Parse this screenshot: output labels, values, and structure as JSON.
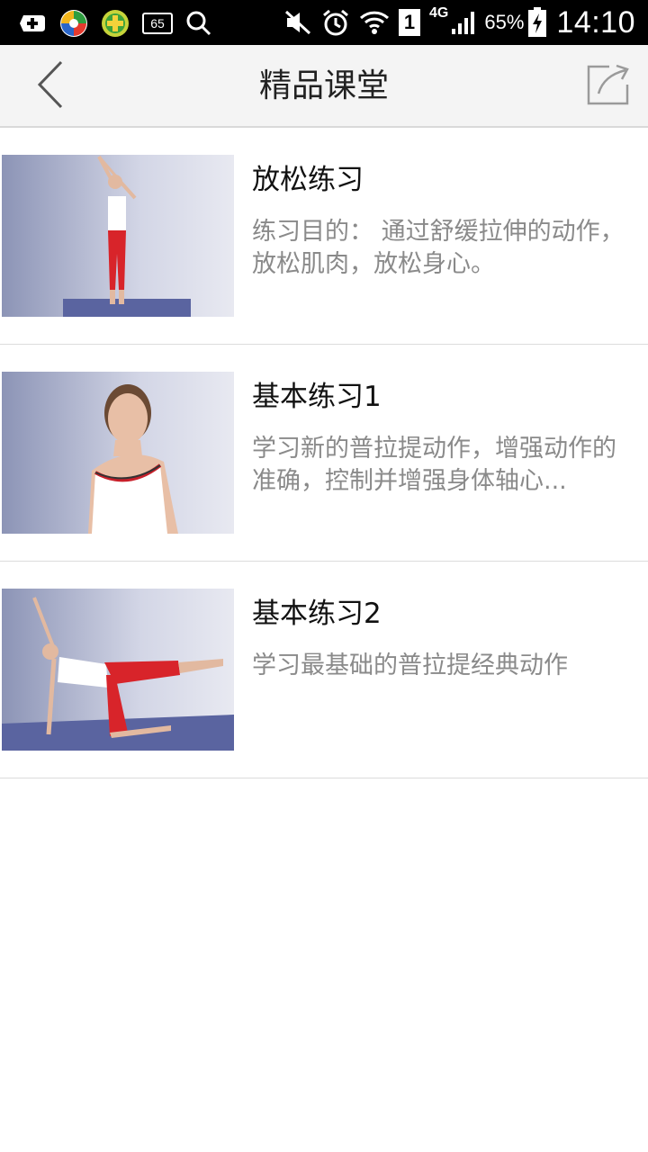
{
  "status_bar": {
    "left_icons": [
      "add-box-icon",
      "colorful-swirl-icon",
      "green-plus-icon",
      "badge-65-icon",
      "search-icon"
    ],
    "badge_text": "65",
    "right_icons": [
      "mute-icon",
      "alarm-icon",
      "wifi-icon",
      "sim-1-icon",
      "signal-4g-icon",
      "battery-charging-icon"
    ],
    "sim_label": "1",
    "network_label": "4G",
    "battery_percent": "65%",
    "time": "14:10"
  },
  "app_bar": {
    "title": "精品课堂",
    "back_icon": "chevron-left-icon",
    "share_icon": "share-icon"
  },
  "courses": [
    {
      "title": "放松练习",
      "description": "练习目的： 通过舒缓拉伸的动作，放松肌肉，放松身心。"
    },
    {
      "title": "基本练习1",
      "description": "学习新的普拉提动作，增强动作的准确，控制并增强身体轴心..."
    },
    {
      "title": "基本练习2",
      "description": "学习最基础的普拉提经典动作"
    }
  ],
  "colors": {
    "status_bar_bg": "#000000",
    "app_bar_bg": "#f4f4f4",
    "title_text": "#111111",
    "desc_text": "#8a8a8a",
    "divider": "#dcdcdc",
    "thumb_bg": "#b7bdd6",
    "mat": "#5a64a0",
    "outfit_red": "#d8242a"
  }
}
